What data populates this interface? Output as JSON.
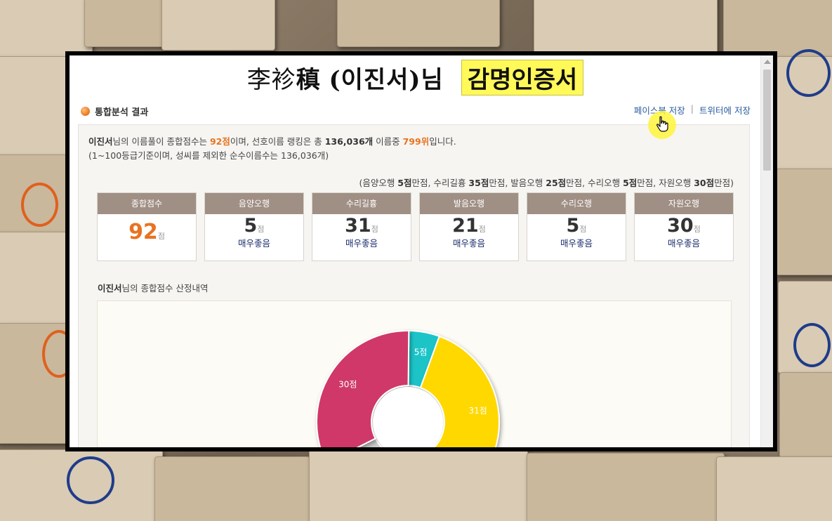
{
  "title": {
    "hanja": "李袗",
    "hanja_bold": "稹",
    "korean": "(이진서)님",
    "badge": "감명인증서"
  },
  "section": {
    "title": "통합분석 결과"
  },
  "share": {
    "facebook": "페이스북 저장",
    "separator": "|",
    "twitter": "트위터에 저장"
  },
  "summary": {
    "name": "이진서",
    "text1": "님의 이름풀이 종합점수는 ",
    "score": "92점",
    "text2": "이며, 선호이름 랭킹은 총 ",
    "total": "136,036개",
    "text3": " 이름중 ",
    "rank": "799위",
    "text4": "입니다.",
    "line2": "(1~100등급기준이며, 성씨를 제외한 순수이름수는 136,036개)"
  },
  "max_note": {
    "p1": "(음양오행 ",
    "v1": "5점",
    "p2": "만점, 수리길흉 ",
    "v2": "35점",
    "p3": "만점, 발음오행 ",
    "v3": "25점",
    "p4": "만점, 수리오행 ",
    "v4": "5점",
    "p5": "만점, 자원오행 ",
    "v5": "30점",
    "p6": "만점)"
  },
  "cards": [
    {
      "label": "종합점수",
      "score": "92",
      "unit": "점",
      "grade": ""
    },
    {
      "label": "음양오행",
      "score": "5",
      "unit": "점",
      "grade": "매우좋음"
    },
    {
      "label": "수리길흉",
      "score": "31",
      "unit": "점",
      "grade": "매우좋음"
    },
    {
      "label": "발음오행",
      "score": "21",
      "unit": "점",
      "grade": "매우좋음"
    },
    {
      "label": "수리오행",
      "score": "5",
      "unit": "점",
      "grade": "매우좋음"
    },
    {
      "label": "자원오행",
      "score": "30",
      "unit": "점",
      "grade": "매우좋음"
    }
  ],
  "breakdown": {
    "name": "이진서",
    "text": "님의 종합점수 산정내역"
  },
  "chart_data": {
    "type": "pie",
    "title": "",
    "slices": [
      {
        "value": 5,
        "label": "5점",
        "color": "#1fc4c8"
      },
      {
        "value": 31,
        "label": "31점",
        "color": "#ffd800"
      },
      {
        "value": 21,
        "label": "",
        "color": "#cccccc"
      },
      {
        "value": 5,
        "label": "",
        "color": "#cccccc"
      },
      {
        "value": 30,
        "label": "30점",
        "color": "#cf3868"
      }
    ]
  },
  "colors": {
    "accent": "#e8731f",
    "card_header": "#a08f84",
    "grade": "#1e2f6e",
    "badge": "#fff95a"
  }
}
